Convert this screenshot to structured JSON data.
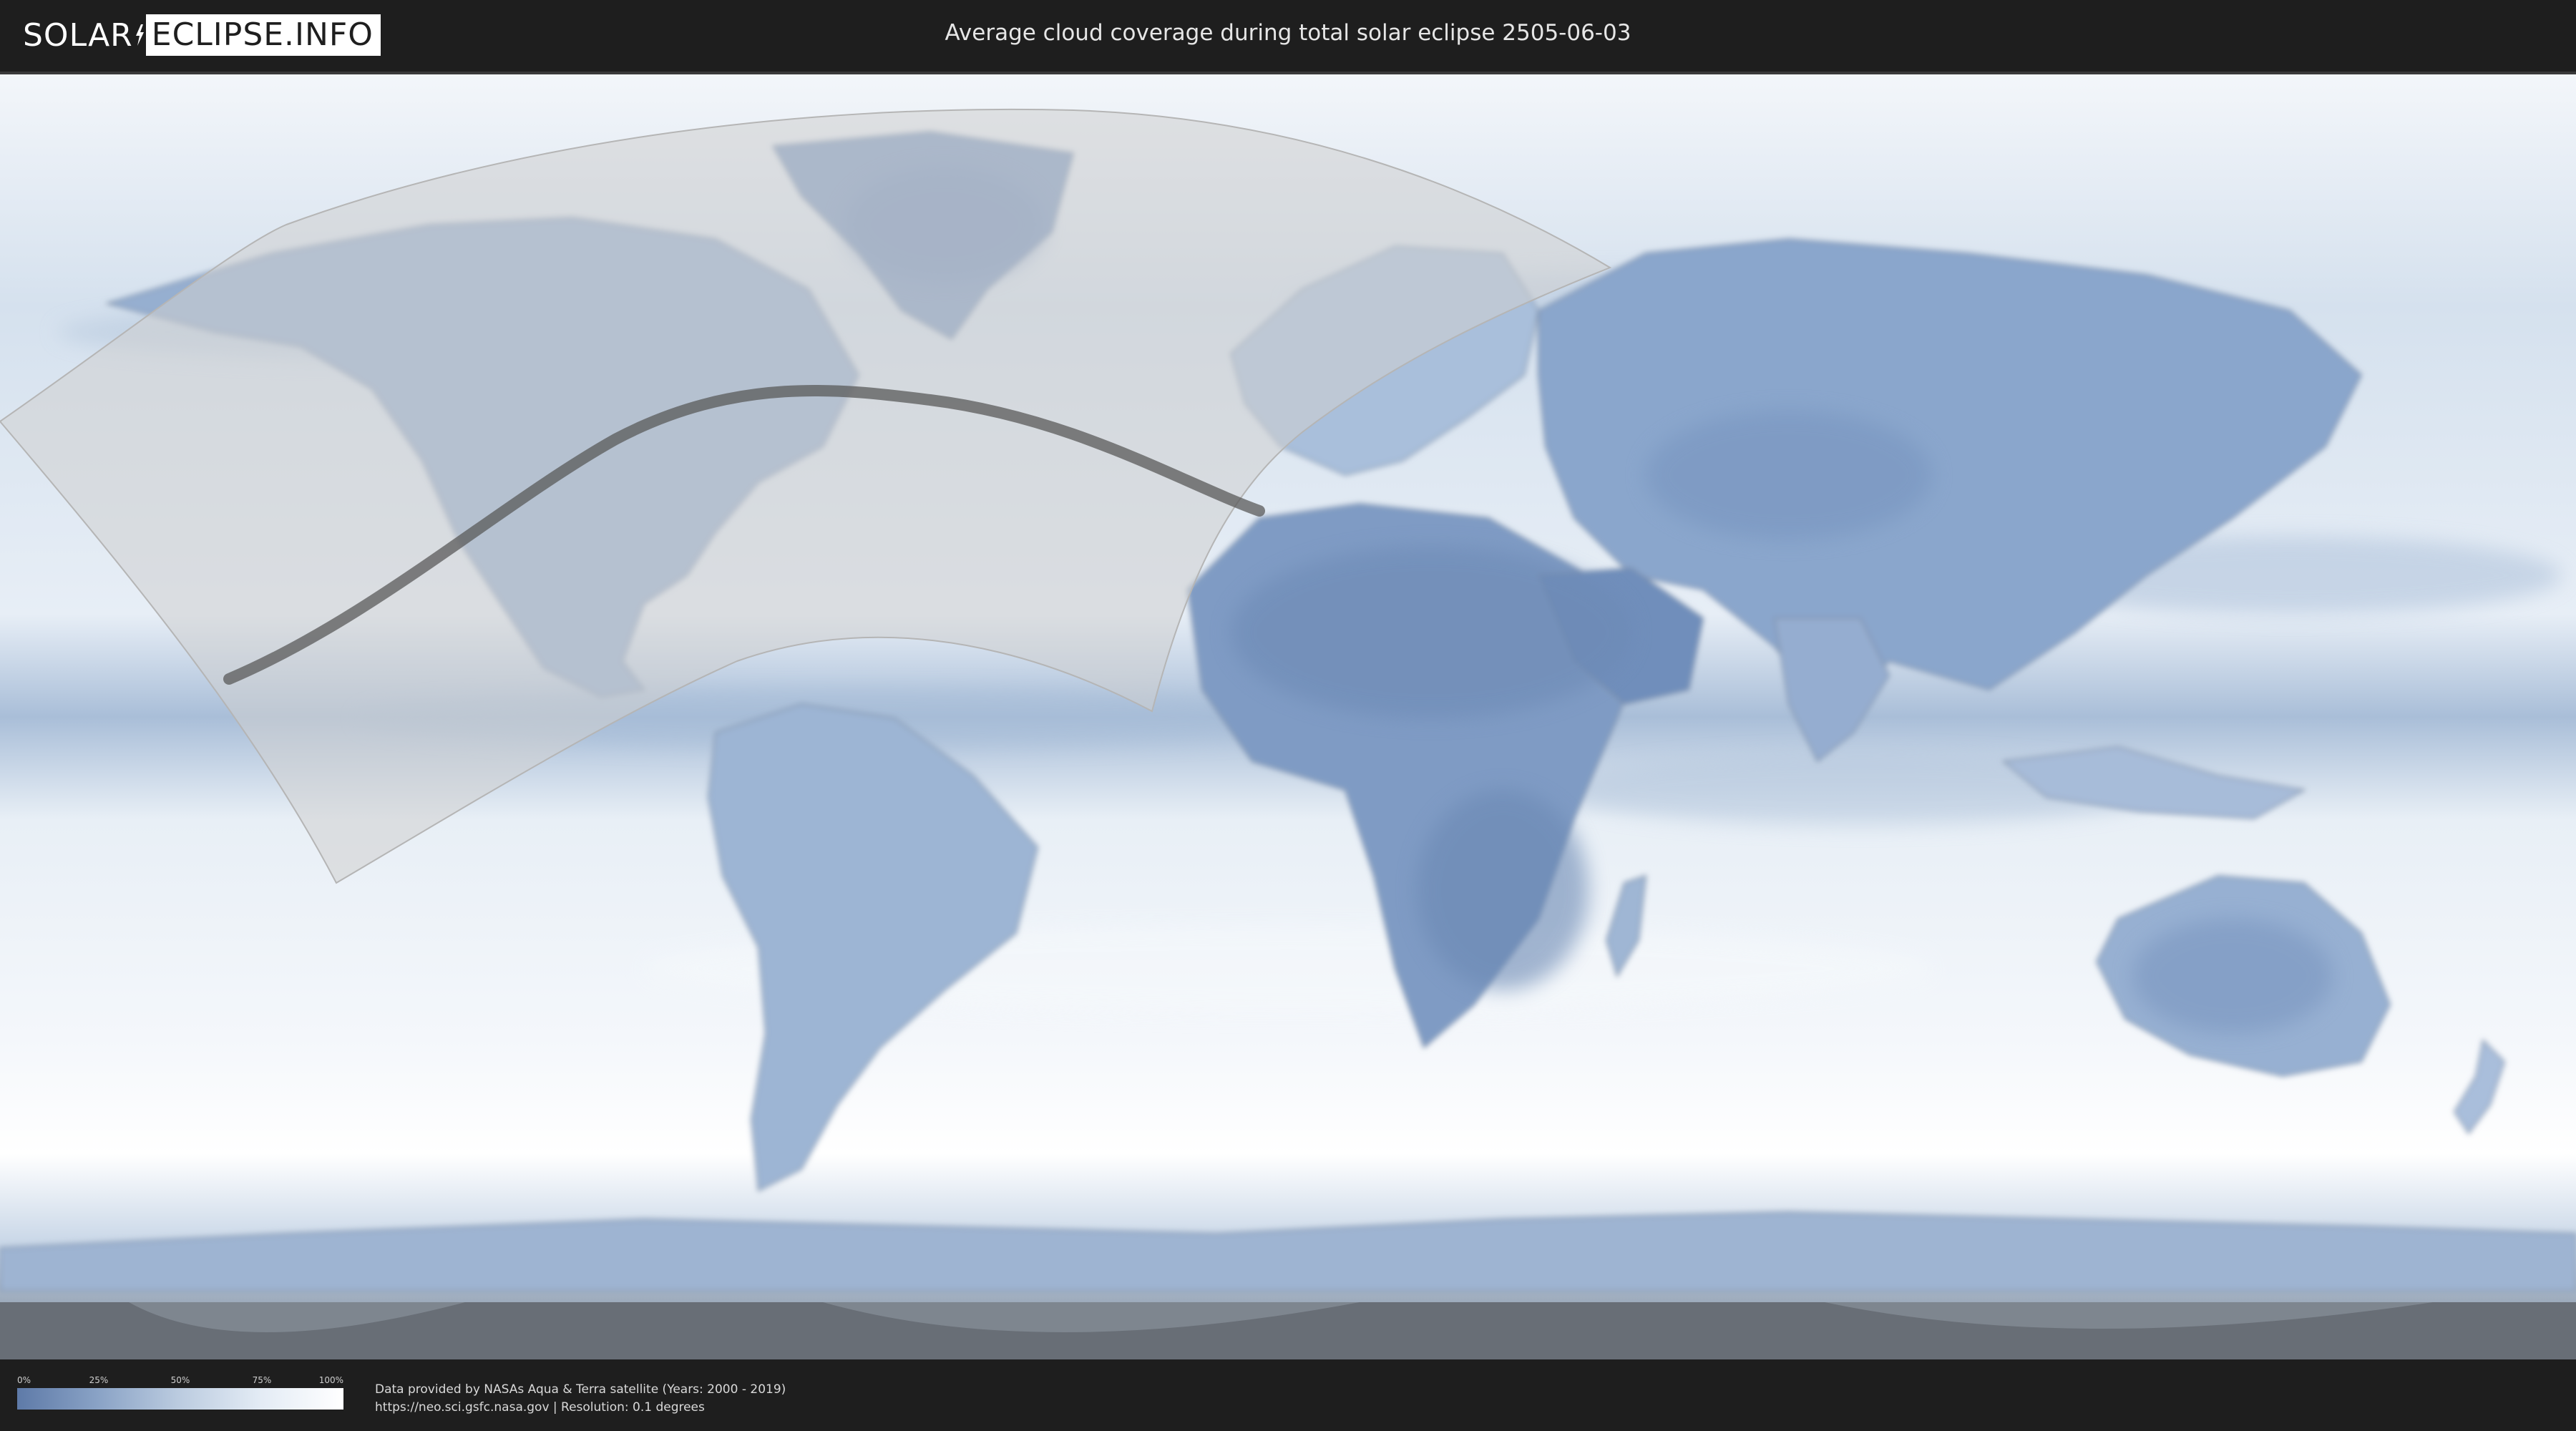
{
  "header": {
    "logo_left": "SOLAR",
    "logo_right": "ECLIPSE.INFO",
    "title": "Average cloud coverage during total solar eclipse 2505-06-03"
  },
  "legend": {
    "ticks": [
      "0%",
      "25%",
      "50%",
      "75%",
      "100%"
    ],
    "colors": {
      "low": "#5e7aa8",
      "high": "#ffffff"
    }
  },
  "credits": {
    "line1": "Data provided by NASAs Aqua & Terra satellite (Years: 2000 - 2019)",
    "line2": "https://neo.sci.gsfc.nasa.gov | Resolution: 0.1 degrees"
  },
  "map": {
    "projection": "equirectangular",
    "colors": {
      "ocean_cloud": "#e9f0f7",
      "land_cloud": "#8ea9cc",
      "dark_cloud": "#6d8ab5",
      "penumbra": "#cfcfcf",
      "path_of_totality": "#5a5a5a"
    },
    "icons": [
      "logo-bolt-icon"
    ]
  }
}
